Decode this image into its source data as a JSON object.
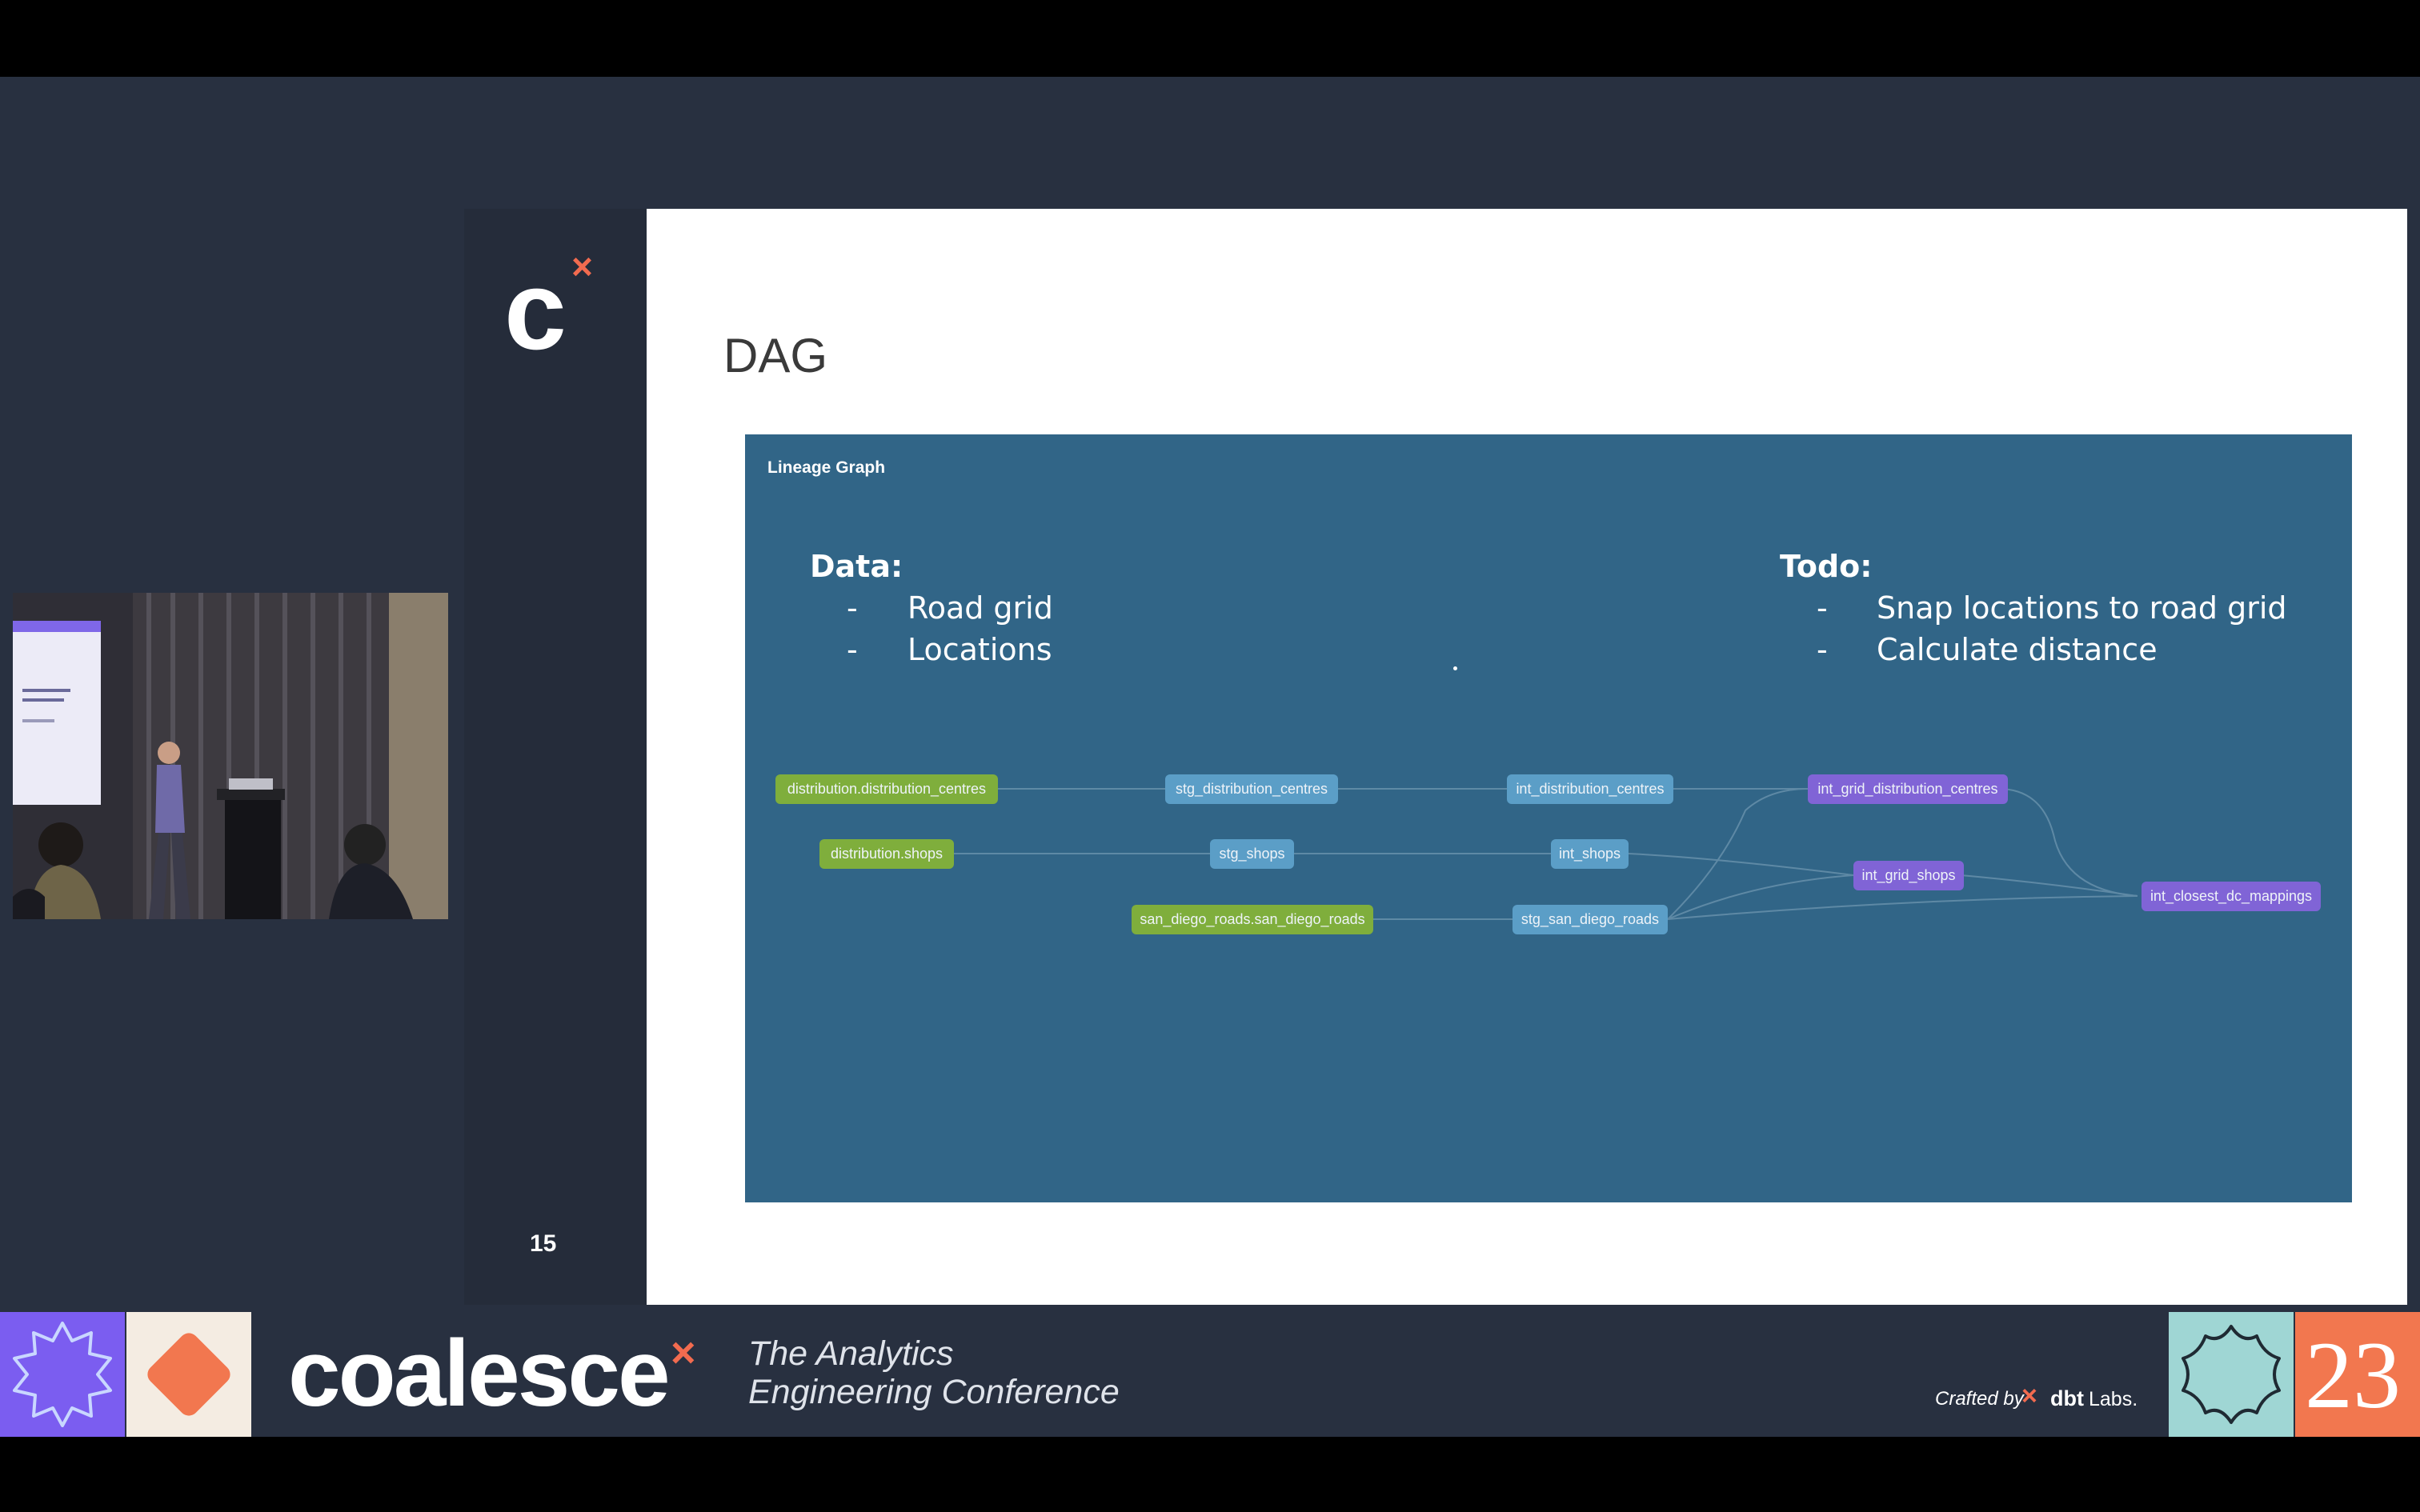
{
  "side_panel": {
    "logo_letter": "c",
    "logo_mark": "×",
    "slide_number": "15"
  },
  "slide": {
    "title": "DAG",
    "graph_title": "Lineage Graph",
    "data_section": {
      "heading": "Data:",
      "bullet": "-",
      "items": [
        "Road grid",
        "Locations"
      ]
    },
    "todo_section": {
      "heading": "Todo:",
      "bullet": "-",
      "items": [
        "Snap locations to road grid",
        "Calculate distance"
      ]
    },
    "nodes": [
      {
        "label": "distribution.distribution_centres",
        "kind": "source"
      },
      {
        "label": "distribution.shops",
        "kind": "source"
      },
      {
        "label": "san_diego_roads.san_diego_roads",
        "kind": "source"
      },
      {
        "label": "stg_distribution_centres",
        "kind": "staging"
      },
      {
        "label": "stg_shops",
        "kind": "staging"
      },
      {
        "label": "stg_san_diego_roads",
        "kind": "staging"
      },
      {
        "label": "int_distribution_centres",
        "kind": "staging"
      },
      {
        "label": "int_shops",
        "kind": "staging"
      },
      {
        "label": "int_grid_distribution_centres",
        "kind": "model"
      },
      {
        "label": "int_grid_shops",
        "kind": "model"
      },
      {
        "label": "int_closest_dc_mappings",
        "kind": "model"
      }
    ],
    "colors": {
      "source": "#7fae3c",
      "staging": "#5b9ec7",
      "model": "#8064d6",
      "graph_bg": "#316587"
    }
  },
  "footer": {
    "brand": "coalesce",
    "brand_mark": "×",
    "tagline_line1": "The Analytics",
    "tagline_line2": "Engineering Conference",
    "crafted_by": "Crafted by",
    "crafted_mark": "×",
    "dbt": "dbt",
    "labs": "Labs.",
    "year": "23",
    "accent": "#f26b4f"
  }
}
